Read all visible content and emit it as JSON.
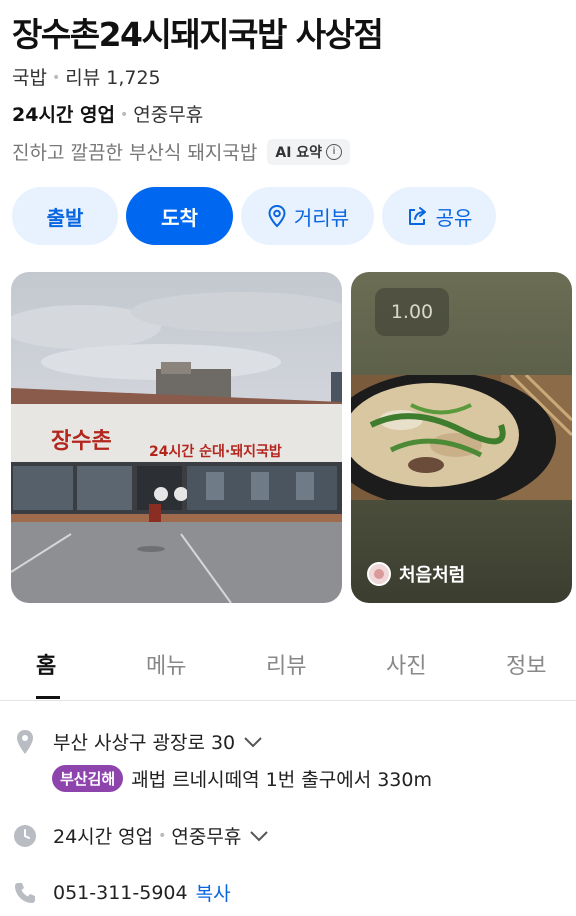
{
  "place": {
    "name": "장수촌24시돼지국밥 사상점",
    "category": "국밥",
    "review_label": "리뷰 1,725",
    "hours_status": "24시간 영업",
    "holiday": "연중무휴",
    "summary": "진하고 깔끔한 부산식 돼지국밥",
    "ai_badge": "AI 요약"
  },
  "actions": {
    "depart": "출발",
    "arrive": "도착",
    "streetview": "거리뷰",
    "share": "공유"
  },
  "photos": {
    "sign_main": "장수촌",
    "sign_sub": "24시간 순대·돼지국밥",
    "side_zoom": "1.00",
    "side_author": "처음처럼"
  },
  "tabs": [
    "홈",
    "메뉴",
    "리뷰",
    "사진",
    "정보"
  ],
  "info": {
    "address": "부산 사상구 광장로 30",
    "subway_line": "부산김해",
    "subway_text": "괘법 르네시떼역 1번 출구에서 330m",
    "hours": "24시간 영업",
    "holiday": "연중무휴",
    "phone": "051-311-5904",
    "copy": "복사"
  },
  "colors": {
    "primary": "#0068f0",
    "primary_light": "#e8f2fe",
    "subway_badge": "#8e44ad"
  }
}
